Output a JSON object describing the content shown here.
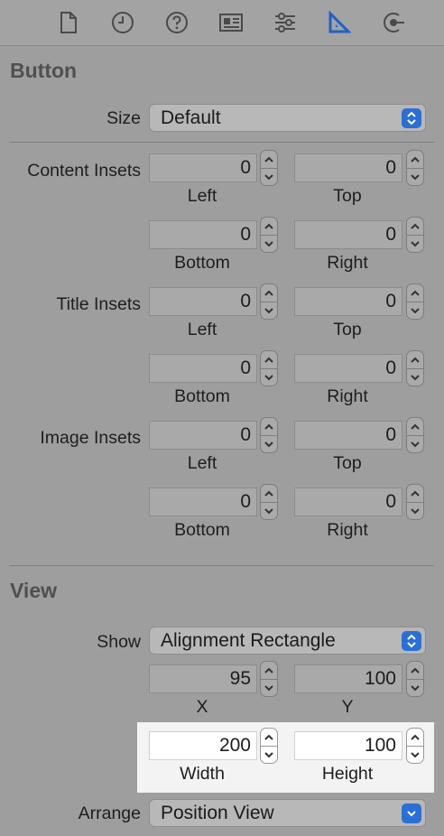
{
  "toolbar": {
    "icons": [
      "file-icon",
      "history-icon",
      "help-icon",
      "identity-icon",
      "attributes-icon",
      "size-ruler-icon",
      "connections-icon"
    ],
    "active_icon": "size-ruler-icon",
    "accent": "#1f62c5"
  },
  "button_section": {
    "title": "Button",
    "size_label": "Size",
    "size_value": "Default",
    "content_insets_label": "Content Insets",
    "title_insets_label": "Title Insets",
    "image_insets_label": "Image Insets",
    "content_insets": {
      "left": "0",
      "top": "0",
      "bottom": "0",
      "right": "0"
    },
    "title_insets": {
      "left": "0",
      "top": "0",
      "bottom": "0",
      "right": "0"
    },
    "image_insets": {
      "left": "0",
      "top": "0",
      "bottom": "0",
      "right": "0"
    },
    "captions": {
      "left": "Left",
      "top": "Top",
      "bottom": "Bottom",
      "right": "Right"
    }
  },
  "view_section": {
    "title": "View",
    "show_label": "Show",
    "show_value": "Alignment Rectangle",
    "x_value": "95",
    "y_value": "100",
    "x_caption": "X",
    "y_caption": "Y",
    "width_value": "200",
    "height_value": "100",
    "width_caption": "Width",
    "height_caption": "Height",
    "arrange_label": "Arrange",
    "arrange_value": "Position View"
  }
}
